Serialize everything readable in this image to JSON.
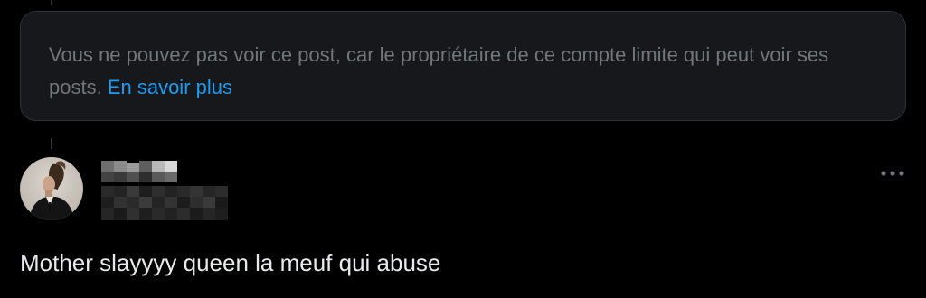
{
  "notice": {
    "message": "Vous ne pouvez pas voir ce post, car le propriétaire de ce compte limite qui peut voir ses posts.",
    "link_label": "En savoir plus"
  },
  "reply": {
    "text": "Mother slayyyy queen la meuf qui abuse"
  },
  "icons": {
    "more": "more-horizontal-icon"
  },
  "colors": {
    "background": "#000000",
    "card": "#16181c",
    "muted_text": "#71767b",
    "link": "#1d9bf0",
    "primary_text": "#e7e9ea"
  }
}
